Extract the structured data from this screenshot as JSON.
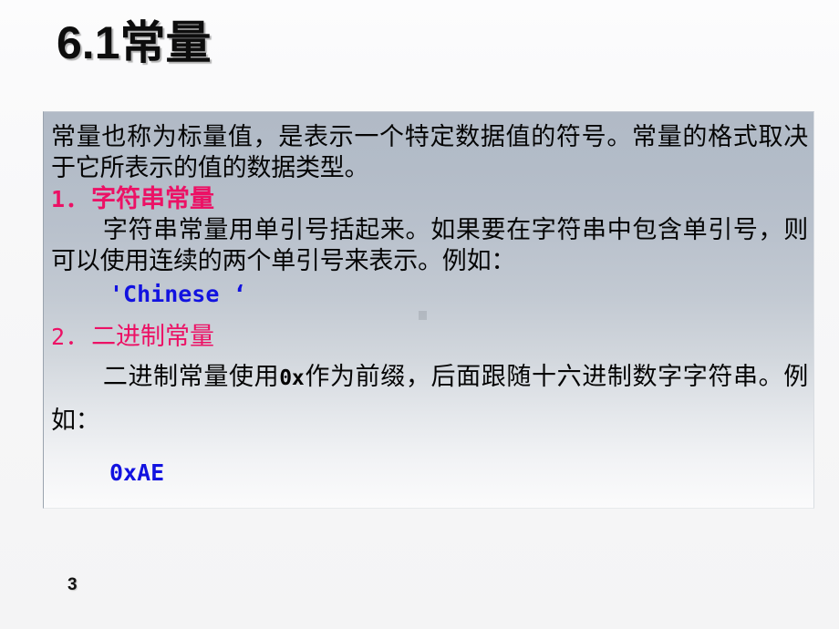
{
  "slide": {
    "title": "6.1常量",
    "page_number": "3",
    "accent_pink": "#ec1165",
    "code_blue": "#1212e0",
    "box_top_color": "#b1bac6",
    "box_bottom_color": "#fbfbfc",
    "background_color": "#f7f7f8"
  },
  "content": {
    "intro_paragraph": "常量也称为标量值，是表示一个特定数据值的符号。常量的格式取决于它所表示的值的数据类型。",
    "section1": {
      "number": "1．",
      "heading": "字符串常量",
      "paragraph": "字符串常量用单引号括起来。如果要在字符串中包含单引号，则可以使用连续的两个单引号来表示。例如：",
      "code": "'Chinese ‘"
    },
    "section2": {
      "number": "2．",
      "heading": "二进制常量",
      "paragraph_before": "二进制常量使用",
      "paragraph_token": "0x",
      "paragraph_after": "作为前缀，后面跟随十六进制数字字符串。例如：",
      "code": "0xAE"
    }
  }
}
